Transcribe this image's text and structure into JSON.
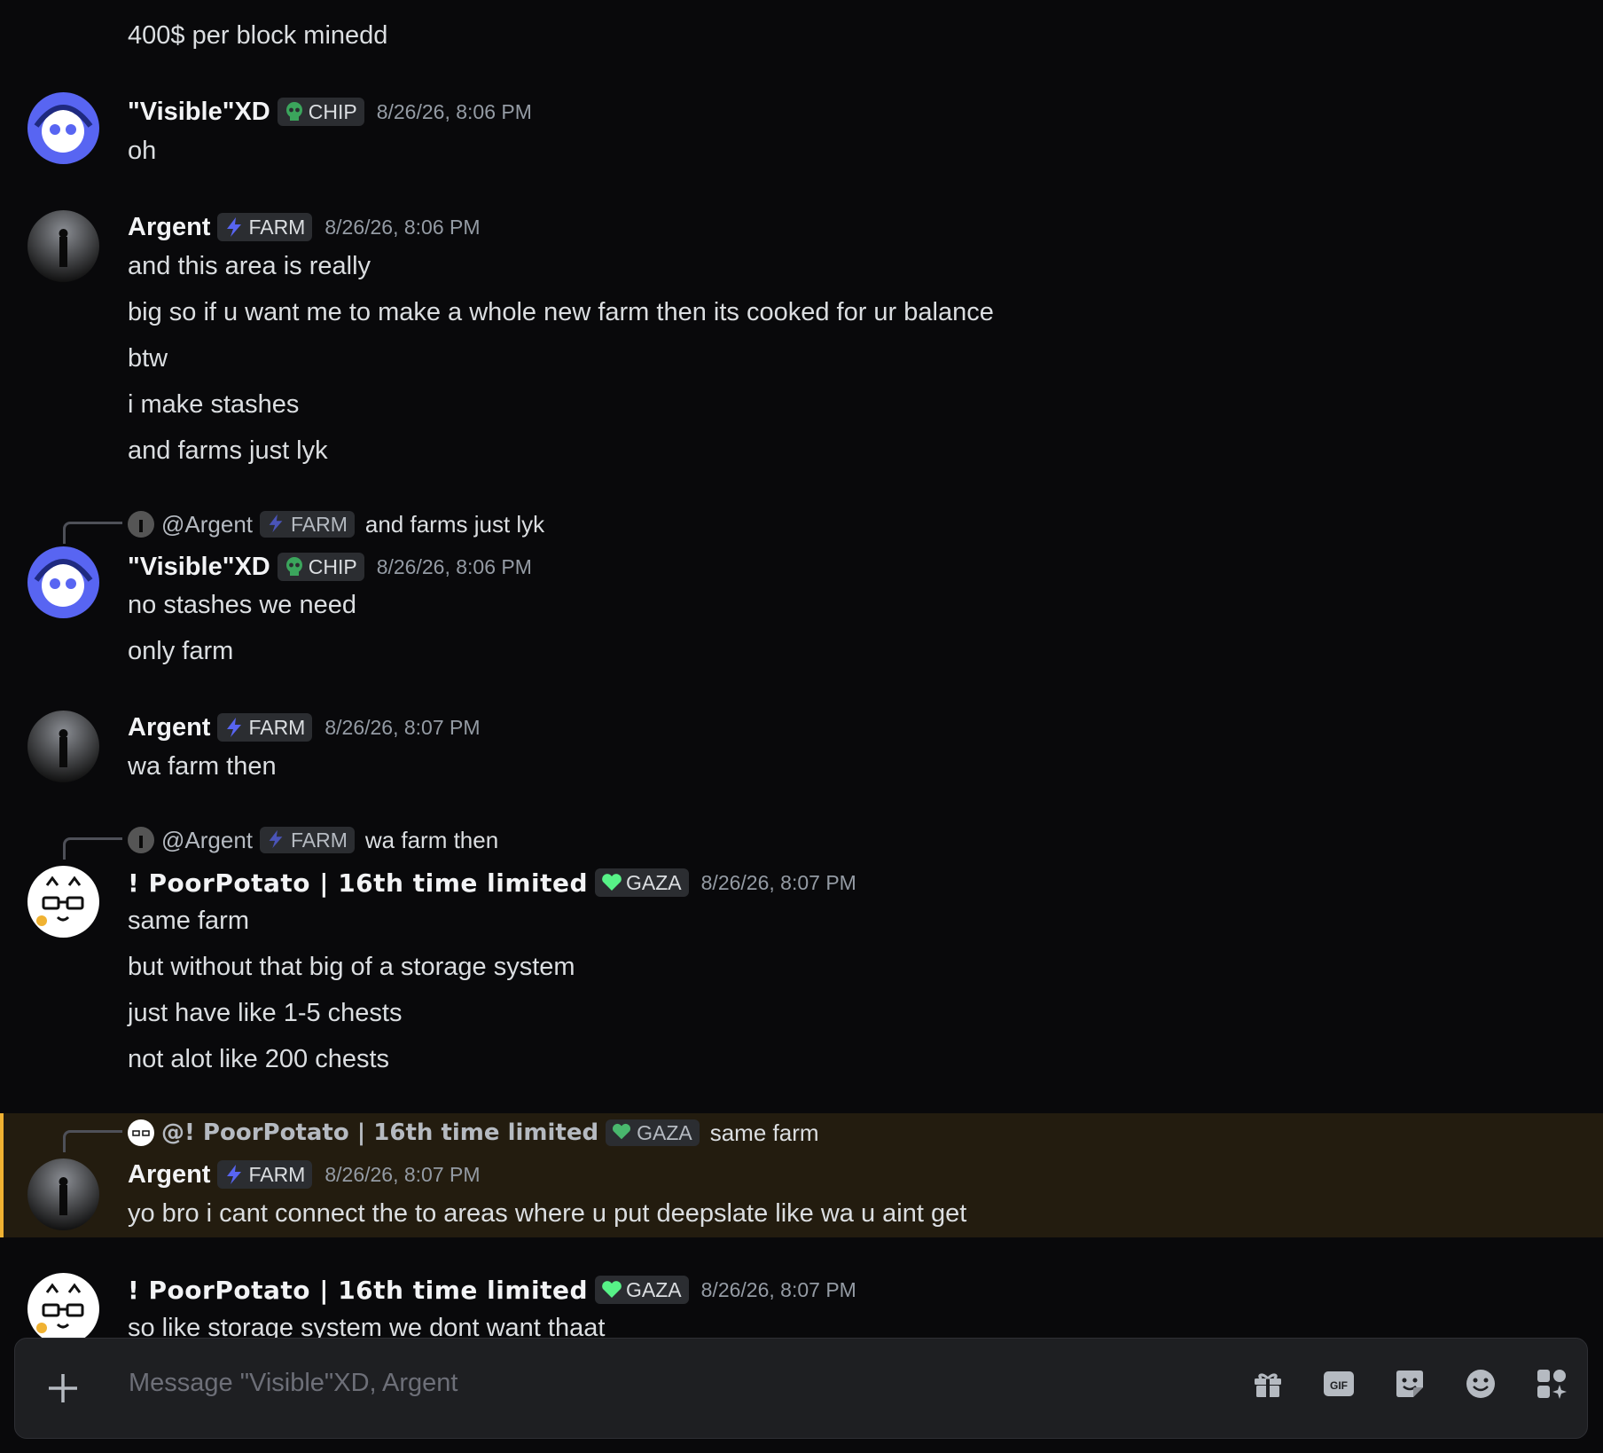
{
  "messages": {
    "m0": {
      "lines": [
        "400$ per block minedd"
      ]
    },
    "m1": {
      "username": "\"Visible\"XD",
      "tag": "CHIP",
      "timestamp": "8/26/26, 8:06 PM",
      "lines": [
        "oh"
      ]
    },
    "m2": {
      "username": "Argent",
      "tag": "FARM",
      "timestamp": "8/26/26, 8:06 PM",
      "lines": [
        "and this area is really",
        "big so if u want me to make a whole new farm then its cooked for ur balance",
        "btw",
        "i make stashes",
        "and farms just lyk"
      ]
    },
    "m3": {
      "reply": {
        "name": "@Argent",
        "tag": "FARM",
        "text": "and farms just lyk"
      },
      "username": "\"Visible\"XD",
      "tag": "CHIP",
      "timestamp": "8/26/26, 8:06 PM",
      "lines": [
        "no stashes we need",
        "only farm"
      ]
    },
    "m4": {
      "username": "Argent",
      "tag": "FARM",
      "timestamp": "8/26/26, 8:07 PM",
      "lines": [
        "wa farm then"
      ]
    },
    "m5": {
      "reply": {
        "name": "@Argent",
        "tag": "FARM",
        "text": "wa farm then"
      },
      "username": "! PoorPotato | 16th time limited",
      "tag": "GAZA",
      "timestamp": "8/26/26, 8:07 PM",
      "lines": [
        "same farm",
        "but without that big of a storage system",
        "just have like 1-5 chests",
        "not alot like 200 chests"
      ]
    },
    "m6": {
      "reply": {
        "name": "@! PoorPotato | 16th time limited",
        "tag": "GAZA",
        "text": "same farm"
      },
      "username": "Argent",
      "tag": "FARM",
      "timestamp": "8/26/26, 8:07 PM",
      "lines": [
        "yo bro i cant connect the  to areas where u put deepslate like wa u aint get"
      ]
    },
    "m7": {
      "username": "! PoorPotato | 16th time limited",
      "tag": "GAZA",
      "timestamp": "8/26/26, 8:07 PM",
      "lines": [
        "so like storage system we dont want thaat"
      ]
    }
  },
  "composer": {
    "placeholder": "Message \"Visible\"XD, Argent",
    "icons": [
      "plus-icon",
      "gift-icon",
      "gif-icon",
      "sticker-icon",
      "emoji-icon",
      "apps-icon"
    ]
  },
  "colors": {
    "background": "#09090b",
    "mention_highlight": "#231c0f",
    "mention_bar": "#f0b232",
    "chip_icon": "#3ba55c",
    "farm_icon": "#5865f2",
    "gaza_icon": "#57f287"
  }
}
